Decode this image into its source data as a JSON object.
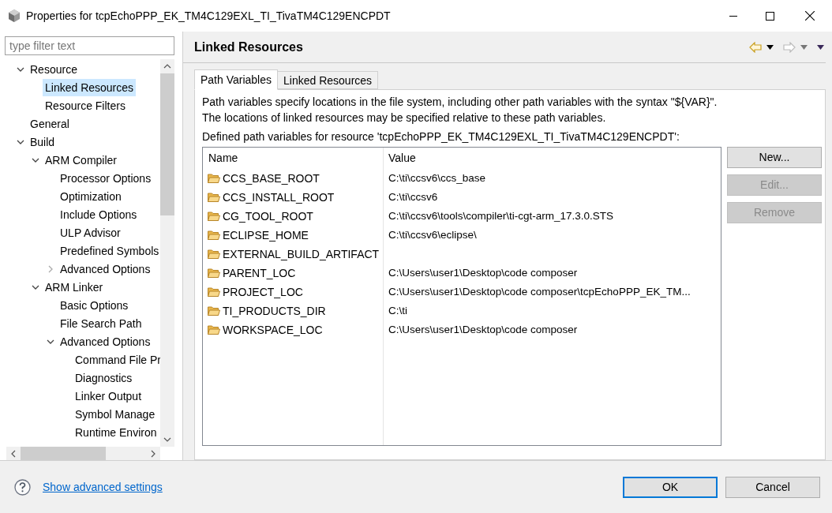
{
  "window": {
    "title": "Properties for tcpEchoPPP_EK_TM4C129EXL_TI_TivaTM4C129ENCPDT"
  },
  "filter": {
    "placeholder": "type filter text"
  },
  "tree": [
    {
      "label": "Resource",
      "selected": false,
      "expanded": true,
      "children": [
        {
          "label": "Linked Resources",
          "selected": true
        },
        {
          "label": "Resource Filters",
          "selected": false
        }
      ]
    },
    {
      "label": "General",
      "selected": false
    },
    {
      "label": "Build",
      "selected": false,
      "expanded": true,
      "children": [
        {
          "label": "ARM Compiler",
          "selected": false,
          "expanded": true,
          "children": [
            {
              "label": "Processor Options",
              "selected": false
            },
            {
              "label": "Optimization",
              "selected": false
            },
            {
              "label": "Include Options",
              "selected": false
            },
            {
              "label": "ULP Advisor",
              "selected": false
            },
            {
              "label": "Predefined Symbols",
              "selected": false
            },
            {
              "label": "Advanced Options",
              "selected": false,
              "expanded": false
            }
          ]
        },
        {
          "label": "ARM Linker",
          "selected": false,
          "expanded": true,
          "children": [
            {
              "label": "Basic Options",
              "selected": false
            },
            {
              "label": "File Search Path",
              "selected": false
            },
            {
              "label": "Advanced Options",
              "selected": false,
              "expanded": true,
              "children": [
                {
                  "label": "Command File Pr",
                  "selected": false
                },
                {
                  "label": "Diagnostics",
                  "selected": false
                },
                {
                  "label": "Linker Output",
                  "selected": false
                },
                {
                  "label": "Symbol Manage",
                  "selected": false
                },
                {
                  "label": "Runtime Environ",
                  "selected": false
                }
              ]
            }
          ]
        }
      ]
    }
  ],
  "page": {
    "title": "Linked Resources"
  },
  "tabs": [
    {
      "label": "Path Variables",
      "selected": true
    },
    {
      "label": "Linked Resources",
      "selected": false
    }
  ],
  "description": [
    "Path variables specify locations in the file system, including other path variables with the syntax \"${VAR}\".",
    "The locations of linked resources may be specified relative to these path variables."
  ],
  "table_caption": "Defined path variables for resource 'tcpEchoPPP_EK_TM4C129EXL_TI_TivaTM4C129ENCPDT':",
  "table": {
    "columns": [
      "Name",
      "Value"
    ],
    "rows": [
      {
        "name": "CCS_BASE_ROOT",
        "value": "C:\\ti\\ccsv6\\ccs_base"
      },
      {
        "name": "CCS_INSTALL_ROOT",
        "value": "C:\\ti\\ccsv6"
      },
      {
        "name": "CG_TOOL_ROOT",
        "value": "C:\\ti\\ccsv6\\tools\\compiler\\ti-cgt-arm_17.3.0.STS"
      },
      {
        "name": "ECLIPSE_HOME",
        "value": "C:\\ti\\ccsv6\\eclipse\\"
      },
      {
        "name": "EXTERNAL_BUILD_ARTIFACT",
        "value": ""
      },
      {
        "name": "PARENT_LOC",
        "value": "C:\\Users\\user1\\Desktop\\code composer"
      },
      {
        "name": "PROJECT_LOC",
        "value": "C:\\Users\\user1\\Desktop\\code composer\\tcpEchoPPP_EK_TM..."
      },
      {
        "name": "TI_PRODUCTS_DIR",
        "value": "C:\\ti"
      },
      {
        "name": "WORKSPACE_LOC",
        "value": "C:\\Users\\user1\\Desktop\\code composer"
      }
    ]
  },
  "side_buttons": [
    {
      "label": "New...",
      "disabled": false
    },
    {
      "label": "Edit...",
      "disabled": true
    },
    {
      "label": "Remove",
      "disabled": true
    }
  ],
  "footer": {
    "link": "Show advanced settings",
    "buttons": [
      {
        "label": "OK",
        "default": true
      },
      {
        "label": "Cancel",
        "default": false
      }
    ]
  }
}
